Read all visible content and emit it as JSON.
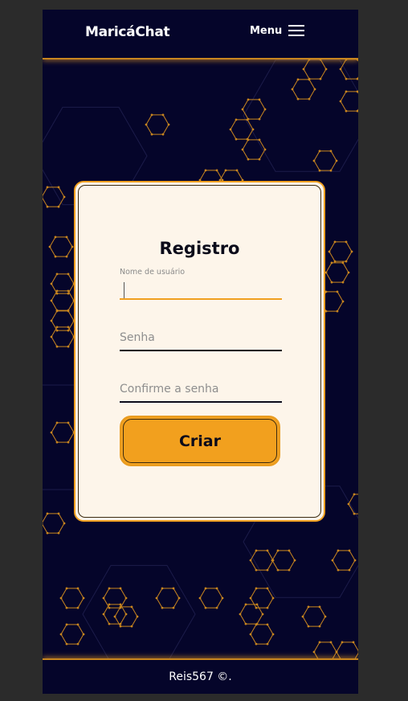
{
  "header": {
    "brand": "MaricáChat",
    "menu_label": "Menu",
    "menu_icon": "hamburger-menu-icon"
  },
  "form": {
    "title": "Registro",
    "username": {
      "label": "Nome de usuário",
      "value": "",
      "placeholder": ""
    },
    "password": {
      "placeholder": "Senha",
      "value": ""
    },
    "confirm_password": {
      "placeholder": "Confirme a senha",
      "value": ""
    },
    "submit_label": "Criar"
  },
  "footer": {
    "text": "Reis567 ©."
  },
  "colors": {
    "background": "#05052a",
    "accent": "#f2a01e",
    "card": "#fdf5ea",
    "text_dark": "#0b0b1a",
    "hex_pattern": "#c9861f"
  }
}
